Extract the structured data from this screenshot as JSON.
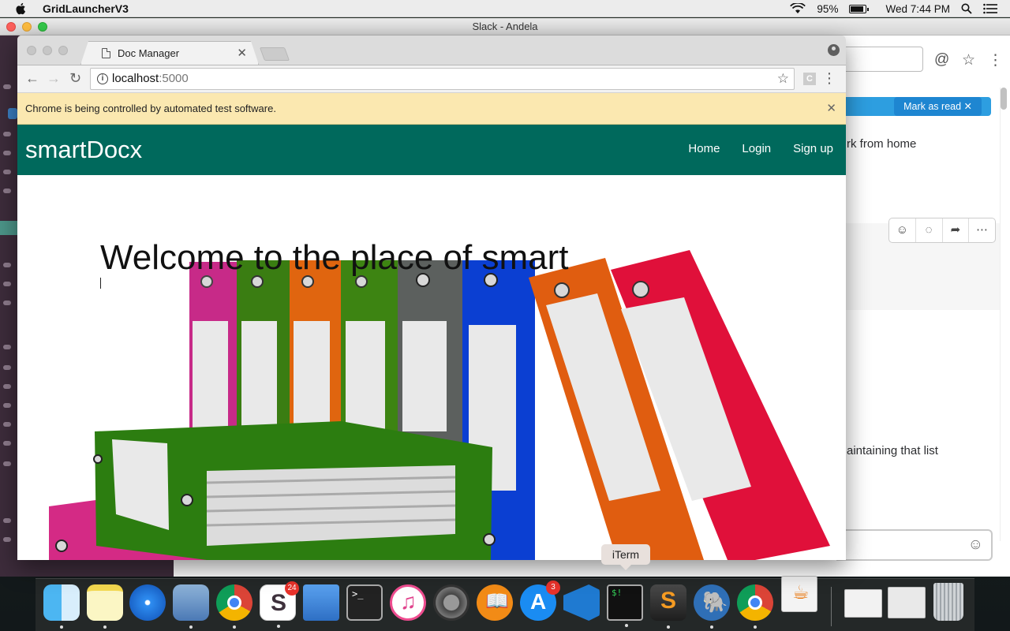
{
  "menubar": {
    "app_name": "GridLauncherV3",
    "battery": "95%",
    "clock": "Wed 7:44 PM"
  },
  "slack": {
    "window_title": "Slack - Andela",
    "mark_read": "Mark as read ✕",
    "message_1": "rk from home",
    "message_2": "aintaining that list"
  },
  "chrome": {
    "tab_title": "Doc Manager",
    "url_host": "localhost",
    "url_port": ":5000",
    "infobar_text": "Chrome is being controlled by automated test software.",
    "ext_label": "C"
  },
  "site": {
    "brand": "smartDocx",
    "nav": [
      "Home",
      "Login",
      "Sign up"
    ],
    "hero_title": "Welcome to the place of smart"
  },
  "dock": {
    "tooltip": "iTerm",
    "items": [
      {
        "name": "finder",
        "badge": ""
      },
      {
        "name": "notes",
        "badge": ""
      },
      {
        "name": "safari",
        "badge": ""
      },
      {
        "name": "mail",
        "badge": ""
      },
      {
        "name": "chrome",
        "badge": ""
      },
      {
        "name": "slack",
        "badge": "24"
      },
      {
        "name": "keynote",
        "badge": ""
      },
      {
        "name": "terminal",
        "badge": ""
      },
      {
        "name": "itunes",
        "badge": ""
      },
      {
        "name": "system-preferences",
        "badge": ""
      },
      {
        "name": "ibooks",
        "badge": ""
      },
      {
        "name": "app-store",
        "badge": "3"
      },
      {
        "name": "vscode",
        "badge": ""
      },
      {
        "name": "iterm",
        "badge": ""
      },
      {
        "name": "sublime-text",
        "badge": ""
      },
      {
        "name": "sequel-pro",
        "badge": ""
      },
      {
        "name": "chrome-canary",
        "badge": ""
      },
      {
        "name": "java",
        "badge": ""
      }
    ]
  },
  "colors": {
    "brand_green": "#00695c",
    "infobar": "#fbe8b0",
    "slack_sidebar": "#3d2c3b",
    "slack_blue": "#1e86d1"
  }
}
